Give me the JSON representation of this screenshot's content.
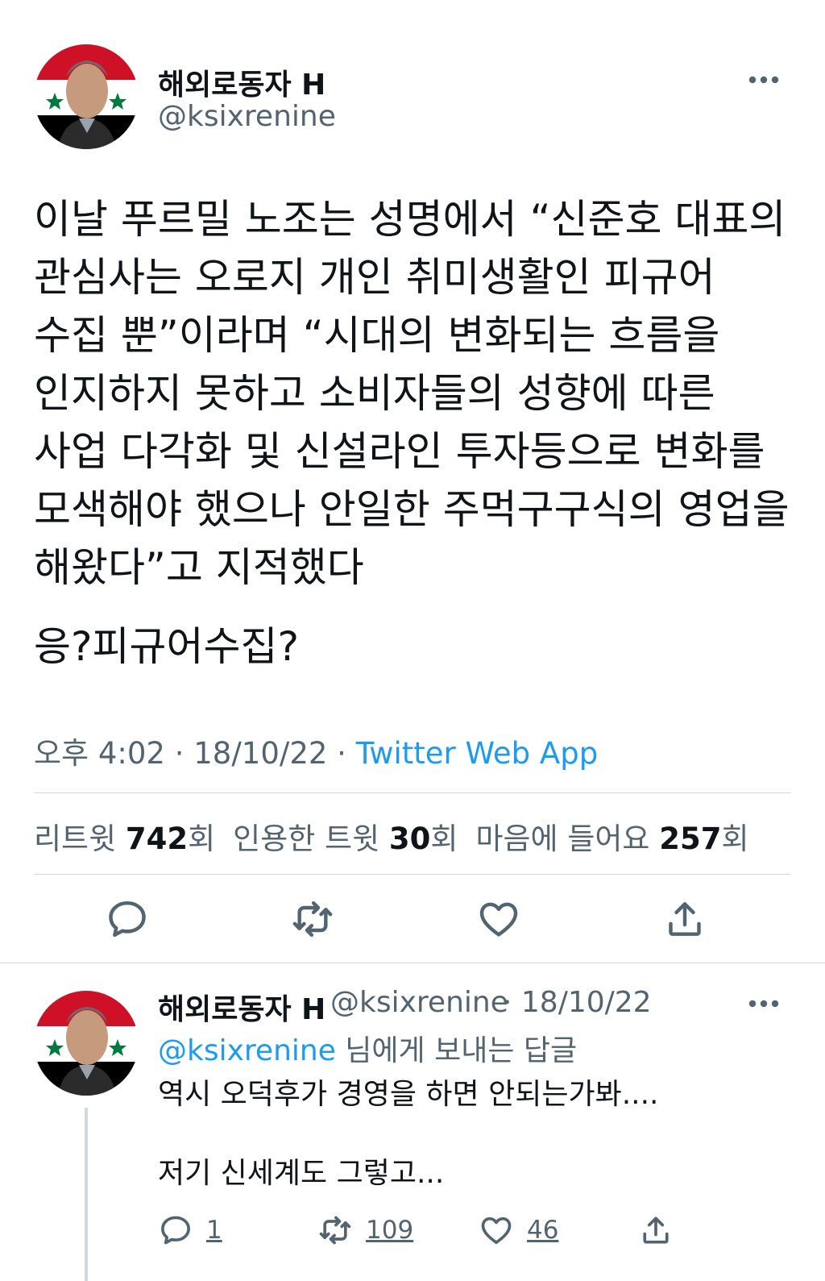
{
  "main_tweet": {
    "author_name": "해외로동자 H",
    "handle": "@ksixrenine",
    "text_paragraph_1": "이날 푸르밀 노조는 성명에서 “신준호 대표의 관심사는 오로지 개인 취미생활인 피규어 수집 뿐”이라며 “시대의 변화되는 흐름을 인지하지 못하고 소비자들의 성향에 따른 사업 다각화 및 신설라인 투자등으로 변화를 모색해야 했으나 안일한 주먹구구식의 영업을 해왔다”고 지적했다",
    "text_paragraph_2": "응?피규어수집?",
    "time": "오후 4:02",
    "date": "18/10/22",
    "separator": " · ",
    "source": "Twitter Web App",
    "stats": {
      "retweets_label": "리트윗",
      "retweets_count": "742",
      "retweets_suffix": "회",
      "quotes_label": "인용한 트윗",
      "quotes_count": "30",
      "quotes_suffix": "회",
      "likes_label": "마음에 들어요",
      "likes_count": "257",
      "likes_suffix": "회"
    }
  },
  "reply_tweet": {
    "author_name": "해외로동자 H",
    "handle": "@ksixrenine",
    "date": "· 18/10/22",
    "reply_mention": "@ksixrenine",
    "reply_suffix": " 님에게 보내는 답글",
    "line_1": "역시 오덕후가 경영을 하면 안되는가봐....",
    "line_2": "저기 신세계도 그렇고...",
    "reply_count": "1",
    "retweet_count": "109",
    "like_count": "46"
  },
  "icons": {
    "reply": "speech-bubble-icon",
    "retweet": "retweet-arrows-icon",
    "like": "heart-icon",
    "share": "share-upload-icon",
    "more": "more-dots-icon"
  },
  "colors": {
    "accent": "#1d9bf0",
    "text": "#0f1419",
    "secondary": "#536471",
    "divider": "#cfd9de"
  }
}
